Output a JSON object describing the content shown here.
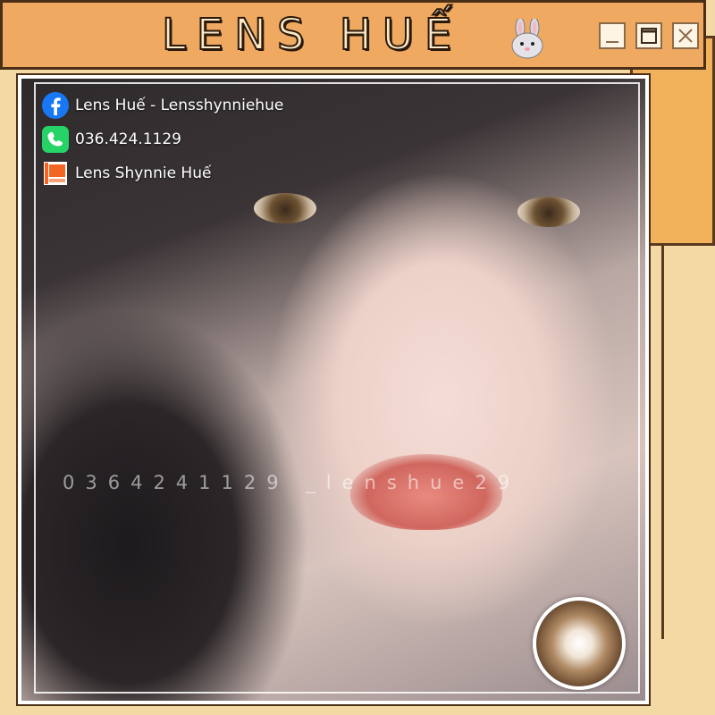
{
  "window": {
    "title": "LENS HUẾ",
    "title_icon": "bunny-icon",
    "buttons": [
      {
        "name": "minimize",
        "icon": "minimize-icon"
      },
      {
        "name": "maximize",
        "icon": "maximize-icon"
      },
      {
        "name": "close",
        "icon": "close-icon"
      }
    ]
  },
  "contacts": {
    "facebook": {
      "icon": "facebook-icon",
      "text": "Lens Huế - Lensshynniehue"
    },
    "phone": {
      "icon": "phone-icon",
      "text": "036.424.1129"
    },
    "shop": {
      "icon": "shop-icon",
      "text": "Lens Shynnie Huế"
    }
  },
  "watermark": "0364241129 _lenshue29",
  "colors": {
    "titlebar": "#efa960",
    "background": "#f3d9a4",
    "accent_window": "#f2b25c",
    "border": "#4a2e15",
    "facebook": "#1877f2",
    "phone": "#25d366",
    "shop": "#f26522"
  }
}
